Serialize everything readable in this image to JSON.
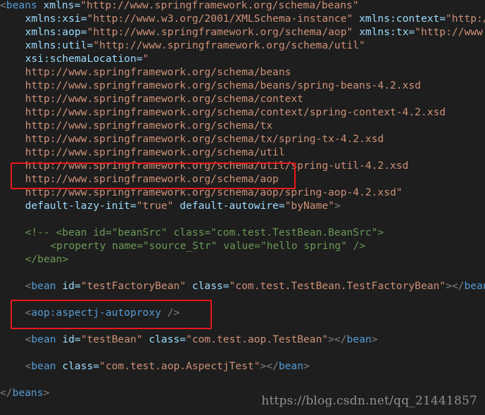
{
  "editor": {
    "background": "#1e1e1e",
    "highlight_color": "#e81919",
    "lines": [
      {
        "indent": 0,
        "tokens": [
          {
            "t": "<",
            "c": "punct"
          },
          {
            "t": "beans ",
            "c": "tag"
          },
          {
            "t": "xmlns=",
            "c": "attr"
          },
          {
            "t": "\"http://www.springframework.org/schema/beans\"",
            "c": "str"
          }
        ]
      },
      {
        "indent": 4,
        "tokens": [
          {
            "t": "xmlns:xsi=",
            "c": "attr"
          },
          {
            "t": "\"http://www.w3.org/2001/XMLSchema-instance\"",
            "c": "str"
          },
          {
            "t": " ",
            "c": "plain"
          },
          {
            "t": "xmlns:context=",
            "c": "attr"
          },
          {
            "t": "\"http://www.springframework.org/schema/context\"",
            "c": "str"
          }
        ]
      },
      {
        "indent": 4,
        "tokens": [
          {
            "t": "xmlns:aop=",
            "c": "attr"
          },
          {
            "t": "\"http://www.springframework.org/schema/aop\"",
            "c": "str"
          },
          {
            "t": " ",
            "c": "plain"
          },
          {
            "t": "xmlns:tx=",
            "c": "attr"
          },
          {
            "t": "\"http://www.springframework.org/schema/tx\"",
            "c": "str"
          }
        ]
      },
      {
        "indent": 4,
        "tokens": [
          {
            "t": "xmlns:util=",
            "c": "attr"
          },
          {
            "t": "\"http://www.springframework.org/schema/util\"",
            "c": "str"
          }
        ]
      },
      {
        "indent": 4,
        "tokens": [
          {
            "t": "xsi:schemaLocation=",
            "c": "attr"
          },
          {
            "t": "\"",
            "c": "str"
          }
        ]
      },
      {
        "indent": 4,
        "tokens": [
          {
            "t": "http://www.springframework.org/schema/beans",
            "c": "str"
          }
        ]
      },
      {
        "indent": 4,
        "tokens": [
          {
            "t": "http://www.springframework.org/schema/beans/spring-beans-4.2.xsd",
            "c": "str"
          }
        ]
      },
      {
        "indent": 4,
        "tokens": [
          {
            "t": "http://www.springframework.org/schema/context",
            "c": "str"
          }
        ]
      },
      {
        "indent": 4,
        "tokens": [
          {
            "t": "http://www.springframework.org/schema/context/spring-context-4.2.xsd",
            "c": "str"
          }
        ]
      },
      {
        "indent": 4,
        "tokens": [
          {
            "t": "http://www.springframework.org/schema/tx",
            "c": "str"
          }
        ]
      },
      {
        "indent": 4,
        "tokens": [
          {
            "t": "http://www.springframework.org/schema/tx/spring-tx-4.2.xsd",
            "c": "str"
          }
        ]
      },
      {
        "indent": 4,
        "tokens": [
          {
            "t": "http://www.springframework.org/schema/util",
            "c": "str"
          }
        ]
      },
      {
        "indent": 4,
        "tokens": [
          {
            "t": "http://www.springframework.org/schema/util/spring-util-4.2.xsd",
            "c": "str"
          }
        ]
      },
      {
        "indent": 4,
        "tokens": [
          {
            "t": "http://www.springframework.org/schema/aop",
            "c": "str"
          }
        ]
      },
      {
        "indent": 4,
        "tokens": [
          {
            "t": "http://www.springframework.org/schema/aop/spring-aop-4.2.xsd\"",
            "c": "str"
          }
        ]
      },
      {
        "indent": 4,
        "tokens": [
          {
            "t": "default-lazy-init=",
            "c": "attr"
          },
          {
            "t": "\"true\"",
            "c": "str"
          },
          {
            "t": " ",
            "c": "plain"
          },
          {
            "t": "default-autowire=",
            "c": "attr"
          },
          {
            "t": "\"byName\"",
            "c": "str"
          },
          {
            "t": ">",
            "c": "punct"
          }
        ]
      },
      {
        "indent": 0,
        "tokens": []
      },
      {
        "indent": 4,
        "tokens": [
          {
            "t": "<!-- <bean id=\"beanSrc\" class=\"com.test.TestBean.BeanSrc\">",
            "c": "comment"
          }
        ]
      },
      {
        "indent": 8,
        "tokens": [
          {
            "t": "<property name=\"source_Str\" value=\"hello spring\" />",
            "c": "comment"
          }
        ]
      },
      {
        "indent": 4,
        "tokens": [
          {
            "t": "</bean>",
            "c": "comment"
          }
        ]
      },
      {
        "indent": 0,
        "tokens": []
      },
      {
        "indent": 4,
        "tokens": [
          {
            "t": "<",
            "c": "punct"
          },
          {
            "t": "bean ",
            "c": "tag"
          },
          {
            "t": "id=",
            "c": "attr"
          },
          {
            "t": "\"testFactoryBean\"",
            "c": "str"
          },
          {
            "t": " ",
            "c": "plain"
          },
          {
            "t": "class=",
            "c": "attr"
          },
          {
            "t": "\"com.test.TestBean.TestFactoryBean\"",
            "c": "str"
          },
          {
            "t": "></",
            "c": "punct"
          },
          {
            "t": "bean",
            "c": "tag"
          },
          {
            "t": ">",
            "c": "punct"
          }
        ]
      },
      {
        "indent": 0,
        "tokens": []
      },
      {
        "indent": 4,
        "tokens": [
          {
            "t": "<",
            "c": "punct"
          },
          {
            "t": "aop:aspectj-autoproxy ",
            "c": "tag"
          },
          {
            "t": "/>",
            "c": "punct"
          }
        ]
      },
      {
        "indent": 0,
        "tokens": []
      },
      {
        "indent": 4,
        "tokens": [
          {
            "t": "<",
            "c": "punct"
          },
          {
            "t": "bean ",
            "c": "tag"
          },
          {
            "t": "id=",
            "c": "attr"
          },
          {
            "t": "\"testBean\"",
            "c": "str"
          },
          {
            "t": " ",
            "c": "plain"
          },
          {
            "t": "class=",
            "c": "attr"
          },
          {
            "t": "\"com.test.aop.TestBean\"",
            "c": "str"
          },
          {
            "t": "></",
            "c": "punct"
          },
          {
            "t": "bean",
            "c": "tag"
          },
          {
            "t": ">",
            "c": "punct"
          }
        ]
      },
      {
        "indent": 0,
        "tokens": []
      },
      {
        "indent": 4,
        "tokens": [
          {
            "t": "<",
            "c": "punct"
          },
          {
            "t": "bean ",
            "c": "tag"
          },
          {
            "t": "class=",
            "c": "attr"
          },
          {
            "t": "\"com.test.aop.AspectjTest\"",
            "c": "str"
          },
          {
            "t": "></",
            "c": "punct"
          },
          {
            "t": "bean",
            "c": "tag"
          },
          {
            "t": ">",
            "c": "punct"
          }
        ]
      },
      {
        "indent": 0,
        "tokens": []
      },
      {
        "indent": 0,
        "tokens": [
          {
            "t": "</",
            "c": "punct"
          },
          {
            "t": "beans",
            "c": "tag"
          },
          {
            "t": ">",
            "c": "punct"
          }
        ]
      }
    ]
  },
  "watermark": "https://blog.csdn.net/qq_21441857"
}
